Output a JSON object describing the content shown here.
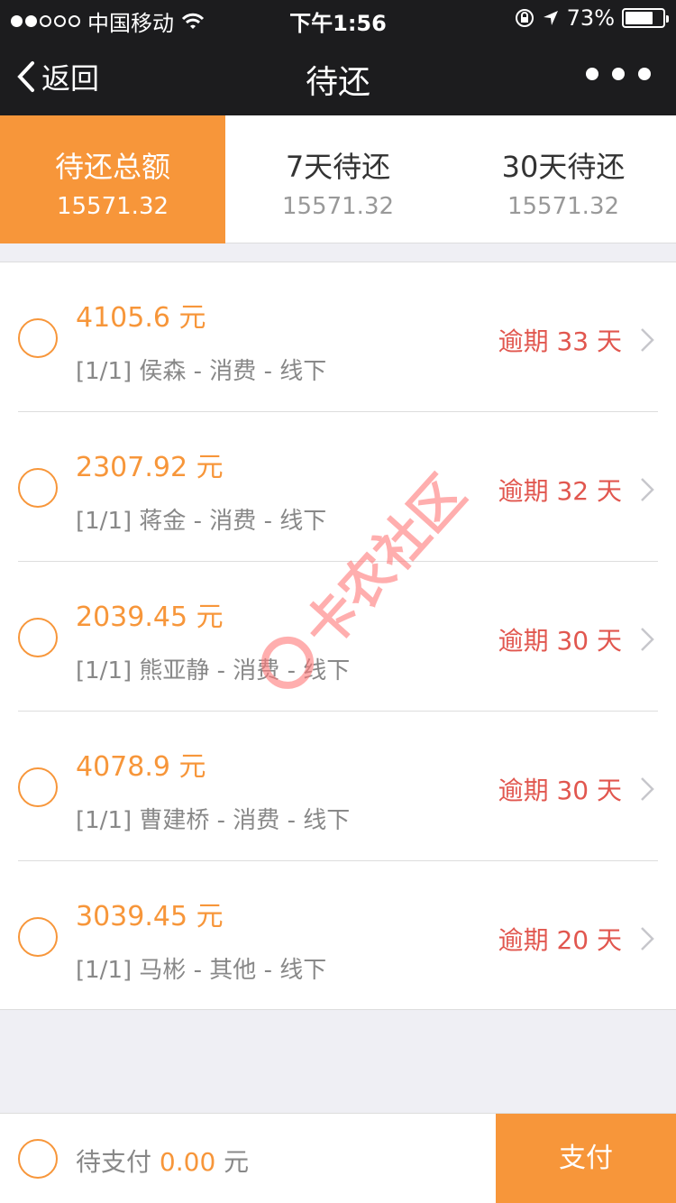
{
  "status_bar": {
    "carrier": "中国移动",
    "time": "下午1:56",
    "battery_percent": "73%",
    "battery_level": 0.73
  },
  "nav": {
    "back_label": "返回",
    "title": "待还"
  },
  "tabs": [
    {
      "label": "待还总额",
      "value": "15571.32",
      "active": true
    },
    {
      "label": "7天待还",
      "value": "15571.32",
      "active": false
    },
    {
      "label": "30天待还",
      "value": "15571.32",
      "active": false
    }
  ],
  "items": [
    {
      "amount": "4105.6 元",
      "desc": "[1/1] 侯森 - 消费 - 线下",
      "overdue": "逾期 33 天"
    },
    {
      "amount": "2307.92 元",
      "desc": "[1/1] 蒋金 - 消费 - 线下",
      "overdue": "逾期 32 天"
    },
    {
      "amount": "2039.45 元",
      "desc": "[1/1] 熊亚静 - 消费 - 线下",
      "overdue": "逾期 30 天"
    },
    {
      "amount": "4078.9 元",
      "desc": "[1/1] 曹建桥 - 消费 - 线下",
      "overdue": "逾期 30 天"
    },
    {
      "amount": "3039.45 元",
      "desc": "[1/1] 马彬 - 其他 - 线下",
      "overdue": "逾期 20 天"
    }
  ],
  "footer": {
    "pending_label": "待支付",
    "pending_amount": "0.00",
    "pending_unit": "元",
    "pay_label": "支付"
  },
  "watermark": {
    "text": "卡农社区"
  },
  "colors": {
    "accent": "#f7963a",
    "overdue": "#e1574f",
    "topbar": "#1c1c1e"
  }
}
